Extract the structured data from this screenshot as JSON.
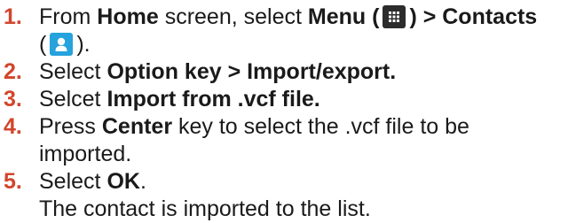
{
  "colors": {
    "step_number": "#d2452c",
    "text": "#1a1a1a",
    "menu_icon_bg": "#2c2c2c",
    "contacts_icon_bg": "#26a2dd"
  },
  "icons": {
    "menu": "menu-grid-icon",
    "contacts": "contacts-person-icon"
  },
  "steps": [
    {
      "number": "1.",
      "parts": [
        "From ",
        "Home",
        " screen, select ",
        "Menu (",
        ") > Contacts",
        "(",
        ")."
      ]
    },
    {
      "number": "2.",
      "parts": [
        "Select ",
        "Option key > Import/export."
      ]
    },
    {
      "number": "3.",
      "parts": [
        "Selcet ",
        "Import from .vcf file."
      ]
    },
    {
      "number": "4.",
      "parts": [
        "Press ",
        "Center",
        " key to select the .vcf file to be",
        "imported."
      ]
    },
    {
      "number": "5.",
      "parts": [
        "Select ",
        "OK",
        "."
      ],
      "note": "The contact is imported to the list."
    }
  ]
}
